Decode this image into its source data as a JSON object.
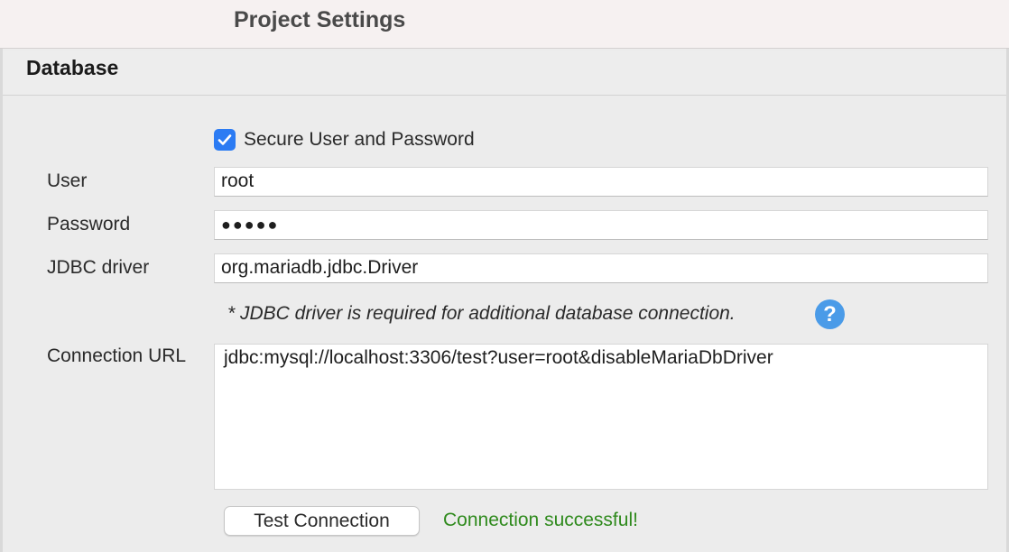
{
  "window": {
    "title": "Project Settings"
  },
  "section": {
    "title": "Database"
  },
  "form": {
    "secure_checkbox": {
      "label": "Secure User and Password",
      "checked": true
    },
    "user": {
      "label": "User",
      "value": "root"
    },
    "password": {
      "label": "Password",
      "value": "●●●●●"
    },
    "jdbc_driver": {
      "label": "JDBC driver",
      "value": "org.mariadb.jdbc.Driver"
    },
    "note": "* JDBC driver is required for additional database connection.",
    "help_icon": "question-circle-icon",
    "connection_url": {
      "label": "Connection URL",
      "value": "jdbc:mysql://localhost:3306/test?user=root&disableMariaDbDriver"
    }
  },
  "actions": {
    "test_button_label": "Test Connection",
    "status_text": "Connection successful!"
  },
  "colors": {
    "accent": "#2b7bf3",
    "help": "#4a9be8",
    "success": "#2f8a1d"
  }
}
